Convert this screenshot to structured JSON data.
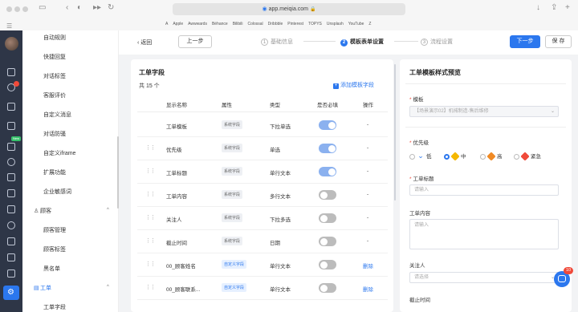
{
  "browser": {
    "url": "app.meiqia.com",
    "bookmarks": [
      "A",
      "Apple",
      "Awwwards",
      "Béhance",
      "Bilibili",
      "Colossal",
      "Dribbble",
      "Pinterest",
      "TOPYS",
      "Unsplash",
      "YouTube",
      "Z"
    ]
  },
  "rail": {
    "chat_badge": "",
    "new_badge": "New"
  },
  "sidebar": {
    "items": [
      {
        "label": "自动规则"
      },
      {
        "label": "快捷回复"
      },
      {
        "label": "对话标签"
      },
      {
        "label": "客服评价"
      },
      {
        "label": "自定义消息"
      },
      {
        "label": "对话防骚"
      },
      {
        "label": "自定义iframe"
      },
      {
        "label": "扩展功能"
      },
      {
        "label": "企业敏感词"
      }
    ],
    "group_customer": {
      "label": "顾客",
      "items": [
        {
          "label": "顾客管理"
        },
        {
          "label": "顾客标签"
        },
        {
          "label": "黑名单"
        }
      ]
    },
    "group_ticket": {
      "label": "工单",
      "items": [
        {
          "label": "工单字段"
        }
      ]
    }
  },
  "stepbar": {
    "back": "返回",
    "prev": "上一步",
    "steps": [
      {
        "num": "1",
        "label": "基础信息"
      },
      {
        "num": "2",
        "label": "模板表单设置"
      },
      {
        "num": "3",
        "label": "流程设置"
      }
    ],
    "next": "下一步",
    "save": "保 存"
  },
  "fields_panel": {
    "title": "工单字段",
    "count": "共 15 个",
    "add_button": "添加模板字段",
    "columns": [
      "显示名称",
      "属性",
      "类型",
      "是否必填",
      "操作"
    ],
    "rows": [
      {
        "name": "工单模板",
        "attr": "系统字段",
        "attr_kind": "sys",
        "type": "下拉单选",
        "required": true,
        "op": "-",
        "draggable": false
      },
      {
        "name": "优先级",
        "attr": "系统字段",
        "attr_kind": "sys",
        "type": "单选",
        "required": true,
        "op": "-",
        "draggable": true
      },
      {
        "name": "工单标题",
        "attr": "系统字段",
        "attr_kind": "sys",
        "type": "单行文本",
        "required": true,
        "op": "-",
        "draggable": true
      },
      {
        "name": "工单内容",
        "attr": "系统字段",
        "attr_kind": "sys",
        "type": "多行文本",
        "required": false,
        "op": "-",
        "draggable": true
      },
      {
        "name": "关注人",
        "attr": "系统字段",
        "attr_kind": "sys",
        "type": "下拉多选",
        "required": false,
        "op": "-",
        "draggable": true
      },
      {
        "name": "截止时间",
        "attr": "系统字段",
        "attr_kind": "sys",
        "type": "日期",
        "required": false,
        "op": "-",
        "draggable": true
      },
      {
        "name": "00_顾客姓名",
        "attr": "自定义字段",
        "attr_kind": "cus",
        "type": "单行文本",
        "required": false,
        "op": "删除",
        "draggable": true
      },
      {
        "name": "00_顾客联系...",
        "attr": "自定义字段",
        "attr_kind": "cus",
        "type": "单行文本",
        "required": false,
        "op": "删除",
        "draggable": true
      }
    ]
  },
  "preview_panel": {
    "title": "工单模板样式预览",
    "template_label": "模板",
    "template_value": "【场景演示02】机械制造-售后维修",
    "priority_label": "优先级",
    "priority_options": [
      {
        "label": "低",
        "color": "#2b77ee"
      },
      {
        "label": "中",
        "color": "#f5b800"
      },
      {
        "label": "高",
        "color": "#f08a24"
      },
      {
        "label": "紧急",
        "color": "#f04a3a"
      }
    ],
    "title_label": "工单标题",
    "title_placeholder": "请输入",
    "content_label": "工单内容",
    "content_placeholder": "请输入",
    "follower_label": "关注人",
    "follower_placeholder": "请选择",
    "deadline_label": "截止时间"
  },
  "chat": {
    "count": "10"
  },
  "colors": {
    "primary": "#2b77ee",
    "rail": "#2e3647",
    "danger": "#f04a3a"
  }
}
